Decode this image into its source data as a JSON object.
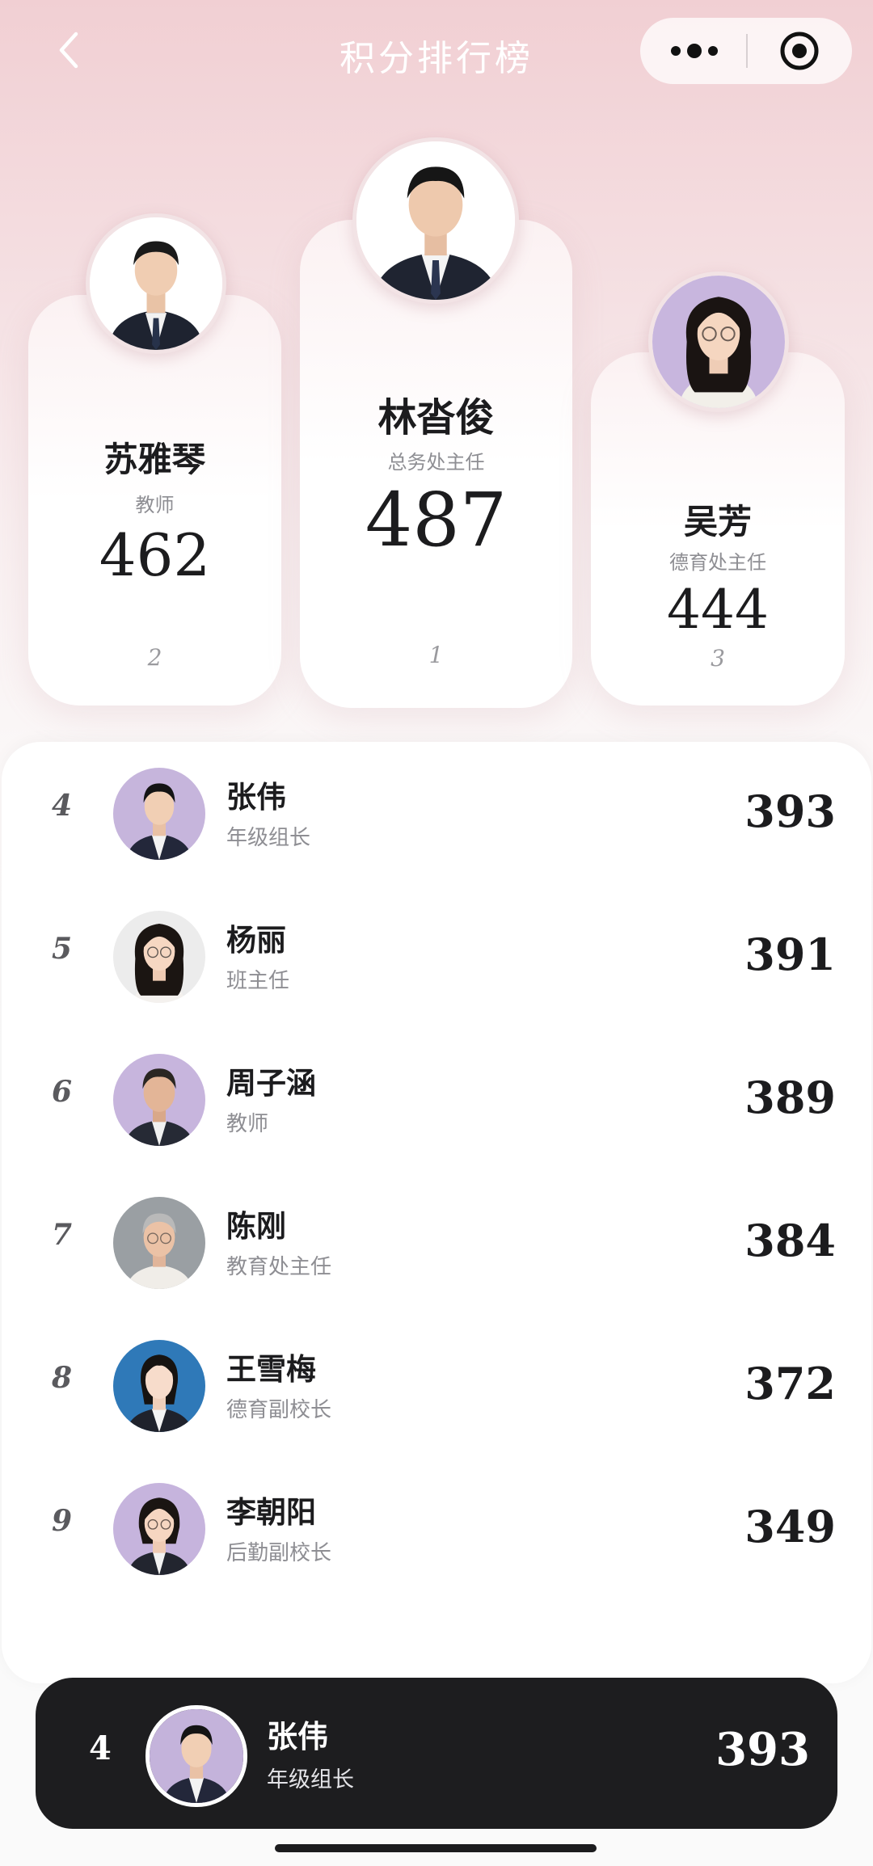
{
  "header": {
    "title": "积分排行榜",
    "back_icon": "chevron-left-icon",
    "menu_icon": "more-dots-icon",
    "close_icon": "target-close-icon"
  },
  "podium": {
    "first": {
      "rank": "1",
      "name": "林沓俊",
      "role": "总务处主任",
      "score": "487"
    },
    "second": {
      "rank": "2",
      "name": "苏雅琴",
      "role": "教师",
      "score": "462"
    },
    "third": {
      "rank": "3",
      "name": "吴芳",
      "role": "德育处主任",
      "score": "444"
    }
  },
  "ranking": [
    {
      "rank": "4",
      "name": "张伟",
      "role": "年级组长",
      "score": "393"
    },
    {
      "rank": "5",
      "name": "杨丽",
      "role": "班主任",
      "score": "391"
    },
    {
      "rank": "6",
      "name": "周子涵",
      "role": "教师",
      "score": "389"
    },
    {
      "rank": "7",
      "name": "陈刚",
      "role": "教育处主任",
      "score": "384"
    },
    {
      "rank": "8",
      "name": "王雪梅",
      "role": "德育副校长",
      "score": "372"
    },
    {
      "rank": "9",
      "name": "李朝阳",
      "role": "后勤副校长",
      "score": "349"
    }
  ],
  "me": {
    "rank": "4",
    "name": "张伟",
    "role": "年级组长",
    "score": "393"
  },
  "colors": {
    "accent_pink": "#f1cfd3",
    "dark_bar": "#1d1d1f",
    "muted_text": "#8e8e93"
  }
}
